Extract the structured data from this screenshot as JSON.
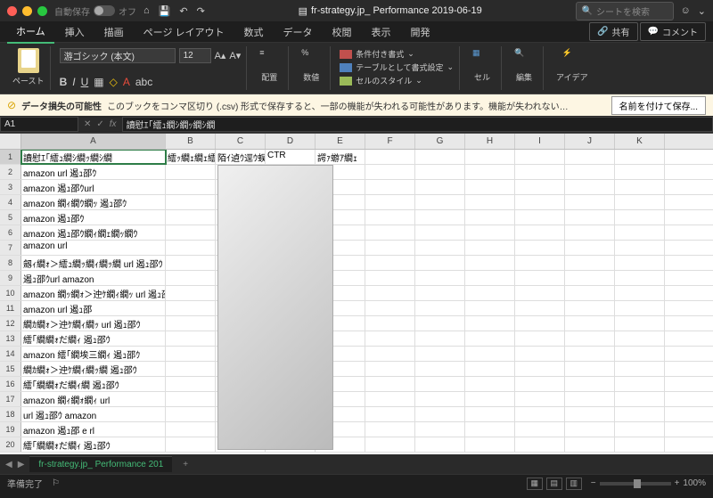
{
  "titlebar": {
    "autosave_label": "自動保存",
    "autosave_state": "オフ",
    "doc_title": "fr-strategy.jp_ Performance 2019-06-19",
    "search_placeholder": "シートを検索"
  },
  "tabs": {
    "items": [
      "ホーム",
      "挿入",
      "描画",
      "ページ レイアウト",
      "数式",
      "データ",
      "校閲",
      "表示",
      "開発"
    ],
    "active_index": 0,
    "share": "共有",
    "comment": "コメント"
  },
  "ribbon": {
    "paste": "ペースト",
    "font_name": "游ゴシック (本文)",
    "font_size": "12",
    "align_label": "配置",
    "number_label": "数値",
    "cond_format": "条件付き書式",
    "table_format": "テーブルとして書式設定",
    "cell_styles": "セルのスタイル",
    "cells": "セル",
    "editing": "編集",
    "ideas": "アイデア"
  },
  "warning": {
    "title": "データ損失の可能性",
    "message": "このブックをコンマ区切り (.csv) 形式で保存すると、一部の機能が失われる可能性があります。機能が失われない…",
    "button": "名前を付けて保存..."
  },
  "formula": {
    "name_box": "A1",
    "content": "讀慰ｴ｢繧ｭ繝ｼ繝ｯ繝ｼ繝"
  },
  "columns": [
    "A",
    "B",
    "C",
    "D",
    "E",
    "F",
    "G",
    "H",
    "I",
    "J",
    "K"
  ],
  "rows": [
    {
      "n": 1,
      "a": "讀慰ｴ｢繧ｭ繝ｼ繝ｯ繝ｼ繝",
      "b": "繧ｯ繝ｪ繝ｪ繧ｫ繧ｨ",
      "c": "陌ｲ遉ｳ逕ｳ蜈",
      "d": "CTR",
      "e": "諤ｧ蝣ｱ繝ｪ"
    },
    {
      "n": 2,
      "a": "amazon url 遏ｭ邵ｳ"
    },
    {
      "n": 3,
      "a": "amazon 遏ｭ邵ｳurl"
    },
    {
      "n": 4,
      "a": "amazon 繝ｨ繝ｳ繝ｯ 遏ｭ邵ｳ"
    },
    {
      "n": 5,
      "a": "amazon 遏ｭ邵ｳ"
    },
    {
      "n": 6,
      "a": "amazon 遏ｭ邵ｳ繝ｨ繝ｪ繝ｯ繝ｳ"
    },
    {
      "n": 7,
      "a": "amazon url"
    },
    {
      "n": 8,
      "a": "劔ｨ繝ｫ＞繧ｭ繝ｯ繝ｨ繝ｯ繝 url 遏ｭ邵ｳ"
    },
    {
      "n": 9,
      "a": "遏ｭ邵ｳurl amazon"
    },
    {
      "n": 10,
      "a": "amazon 繝ｯ繝ｫ＞迚ｹ繝ｨ繝ｯ url 遏ｭ邵"
    },
    {
      "n": 11,
      "a": "amazon url 遏ｭ邵"
    },
    {
      "n": 12,
      "a": "繝ｶ繝ｫ＞迚ｹ繝ｨ繝ｯ url 遏ｭ邵ｳ"
    },
    {
      "n": 13,
      "a": "繧｢繝繝ｫだ繝ｨ 遏ｭ邵ｳ"
    },
    {
      "n": 14,
      "a": "amazon 繧｢繝埃三繝ｨ 遏ｭ邵ｳ"
    },
    {
      "n": 15,
      "a": "繝ｶ繝ｫ＞迚ｹ繝ｨ繝ｯ繝 遏ｭ邵ｳ"
    },
    {
      "n": 16,
      "a": "繧｢繝繝ｫだ繝ｨ繝 遏ｭ邵ｳ"
    },
    {
      "n": 17,
      "a": "amazon 繝ｨ繝ｫ繝ｨ url"
    },
    {
      "n": 18,
      "a": "url 遏ｭ邵ｳ amazon"
    },
    {
      "n": 19,
      "a": "amazon 遏ｭ邵 e rl"
    },
    {
      "n": 20,
      "a": "繧｢繝繝ｫだ繝ｨ 遏ｭ邵ｳ"
    }
  ],
  "sheet": {
    "tab_name": "fr-strategy.jp_ Performance 201"
  },
  "status": {
    "ready": "準備完了",
    "zoom": "100%"
  }
}
